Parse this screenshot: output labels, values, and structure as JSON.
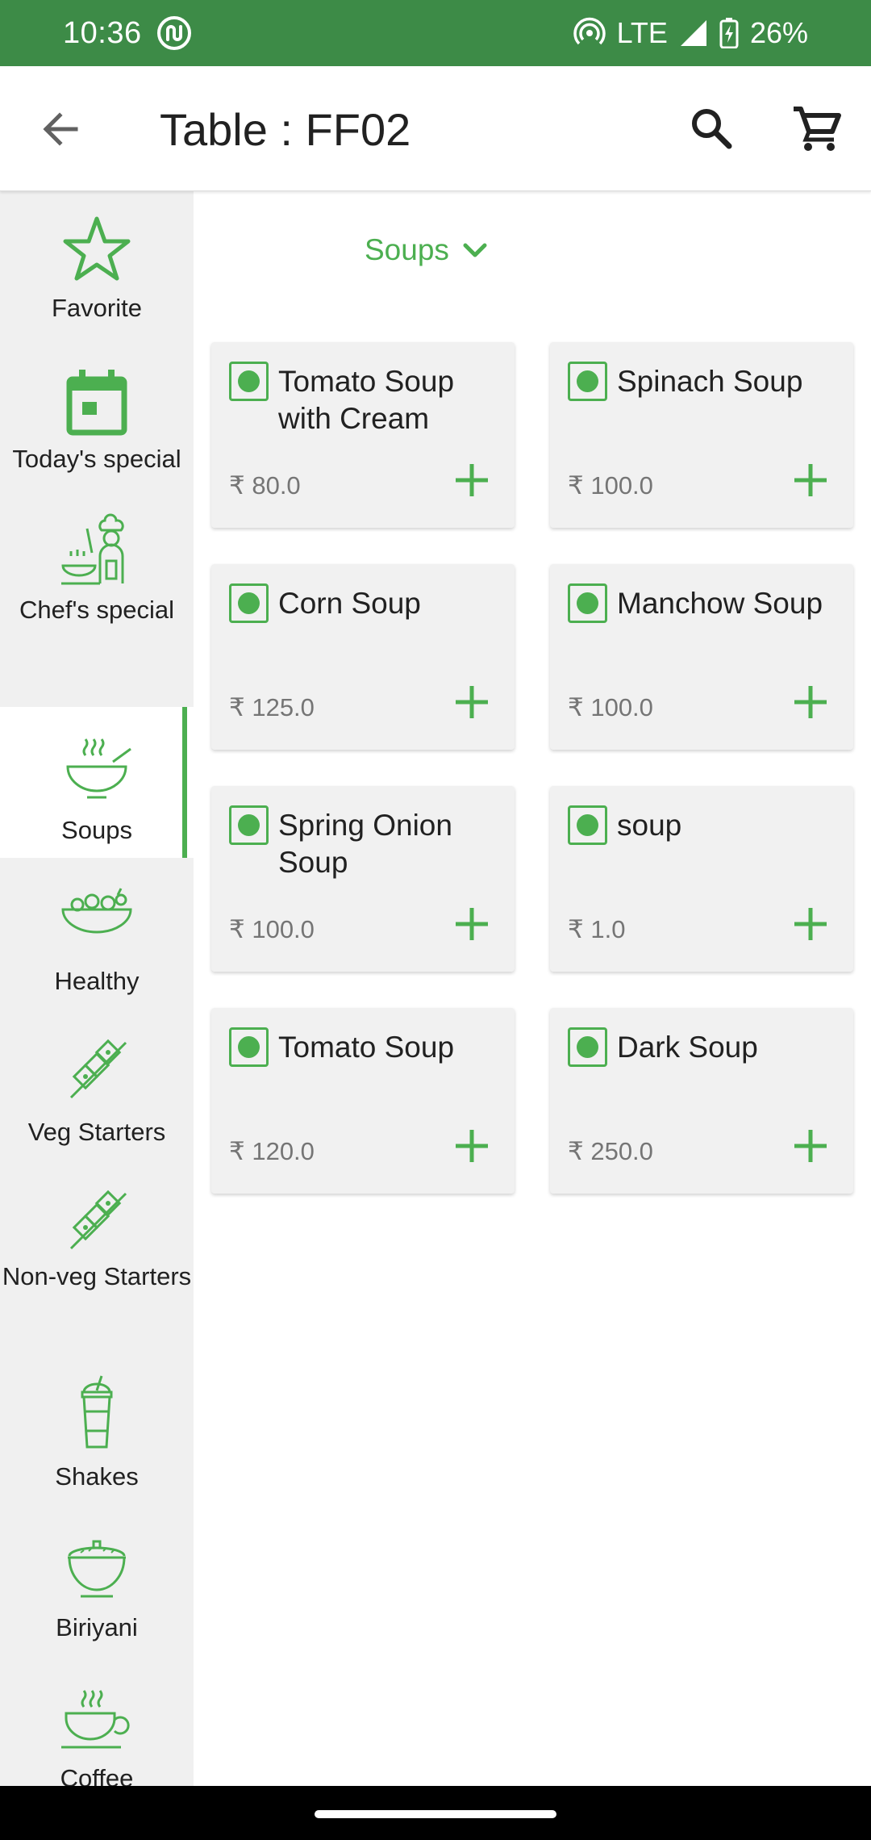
{
  "status_bar": {
    "time": "10:36",
    "network": "LTE",
    "battery": "26%",
    "app_icon": "app-notification-icon",
    "background": "#3d8b47"
  },
  "app_bar": {
    "title": "Table : FF02",
    "back_icon": "arrow-back-icon",
    "search_icon": "search-icon",
    "cart_icon": "cart-icon"
  },
  "sidebar": {
    "selected": "Soups",
    "accent": "#4caf50",
    "items": [
      {
        "label": "Favorite",
        "icon": "star-icon"
      },
      {
        "label": "Today's special",
        "icon": "calendar-icon"
      },
      {
        "label": "Chef's special",
        "icon": "chef-icon"
      },
      {
        "label": "Soups",
        "icon": "soup-bowl-icon"
      },
      {
        "label": "Healthy",
        "icon": "salad-bowl-icon"
      },
      {
        "label": "Veg Starters",
        "icon": "skewer-icon"
      },
      {
        "label": "Non-veg Starters",
        "icon": "skewer-icon"
      },
      {
        "label": "Shakes",
        "icon": "shake-cup-icon"
      },
      {
        "label": "Biriyani",
        "icon": "biriyani-pot-icon"
      },
      {
        "label": "Coffee",
        "icon": "coffee-cup-icon"
      }
    ]
  },
  "category_dropdown": {
    "label": "Soups",
    "icon": "chevron-down-icon"
  },
  "items": [
    {
      "name": "Tomato Soup with Cream",
      "price": "₹ 80.0"
    },
    {
      "name": "Spinach Soup",
      "price": "₹ 100.0"
    },
    {
      "name": "Corn Soup",
      "price": "₹ 125.0"
    },
    {
      "name": "Manchow Soup",
      "price": "₹ 100.0"
    },
    {
      "name": "Spring Onion Soup",
      "price": "₹ 100.0"
    },
    {
      "name": "soup",
      "price": "₹ 1.0"
    },
    {
      "name": "Tomato Soup",
      "price": "₹ 120.0"
    },
    {
      "name": "Dark Soup",
      "price": "₹ 250.0"
    }
  ],
  "item_icons": {
    "veg": "veg-indicator-icon",
    "add": "plus-icon"
  },
  "colors": {
    "accent": "#4caf50",
    "card_bg": "#f1f1f1",
    "sidebar_bg": "#f0f0f0"
  }
}
